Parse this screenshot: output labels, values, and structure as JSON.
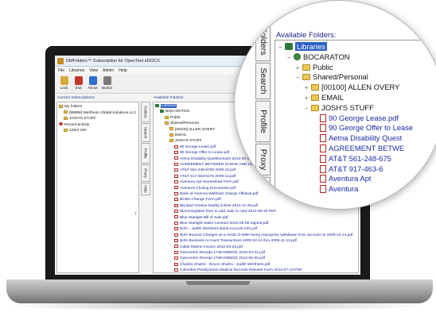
{
  "window": {
    "title": "DMFolders™ Subscription for OpenText eDOCS",
    "minimize": "–",
    "maximize": "□",
    "close": "×"
  },
  "menu": [
    "File",
    "Libraries",
    "View",
    "Admin",
    "Help"
  ],
  "toolbar": {
    "buttons": [
      {
        "label": "Lock",
        "icon": "lock-icon",
        "color": "#d8a93a"
      },
      {
        "label": "Exit",
        "icon": "exit-icon",
        "color": "#c0392b"
      },
      {
        "label": "About",
        "icon": "about-icon",
        "color": "#2e6fcf"
      },
      {
        "label": "Button",
        "icon": "button-icon",
        "color": "#7a7a7a"
      }
    ]
  },
  "left_panel": {
    "header": "Current Subscriptions:",
    "tree": [
      {
        "label": "My folders",
        "level": 0,
        "icon": "folder"
      },
      {
        "label": "[99999] Wertheim Global Solutions LLC",
        "level": 1,
        "icon": "folder"
      },
      {
        "label": "JOSH'S STUFF",
        "level": 1,
        "icon": "folder"
      },
      {
        "label": "Recent activity",
        "level": 0,
        "icon": "clock"
      },
      {
        "label": "Client 100",
        "level": 1,
        "icon": "folder"
      }
    ]
  },
  "tabs": [
    "Folders",
    "Search",
    "Profile",
    "Proxy",
    "Help"
  ],
  "right_panel": {
    "header": "Available Folders:",
    "tree": [
      {
        "label": "Libraries",
        "level": 0,
        "type": "lib"
      },
      {
        "label": "BOCARATON",
        "level": 1,
        "type": "db"
      },
      {
        "label": "Public",
        "level": 2,
        "type": "folder"
      },
      {
        "label": "Shared/Personal",
        "level": 2,
        "type": "folder"
      },
      {
        "label": "[00100] ALLEN OVERY",
        "level": 3,
        "type": "folder"
      },
      {
        "label": "EMAIL",
        "level": 3,
        "type": "folder"
      },
      {
        "label": "JOSH'S STUFF",
        "level": 3,
        "type": "folder"
      },
      {
        "label": "90 George Lease.pdf",
        "level": 4,
        "type": "pdf"
      },
      {
        "label": "90 George Offer to Lease.pdf",
        "level": 4,
        "type": "pdf"
      },
      {
        "label": "Aetna Disability Questionnaire 2012-02-29",
        "level": 4,
        "type": "pdf"
      },
      {
        "label": "AGREEMENT BETWEEN GLENN AND LE",
        "level": 4,
        "type": "pdf"
      },
      {
        "label": "AT&T 561-248-6759 2009-12.pdf",
        "level": 4,
        "type": "pdf"
      },
      {
        "label": "AT&T 917-463-6175 2009-12.pdf",
        "level": 4,
        "type": "pdf"
      },
      {
        "label": "Aventura Apt Homestead Form.pdf",
        "level": 4,
        "type": "pdf"
      },
      {
        "label": "Aventura Closing Documents.pdf",
        "level": 4,
        "type": "pdf"
      },
      {
        "label": "Bank of America Walfmart Charge Affidavit.pdf",
        "level": 4,
        "type": "pdf"
      },
      {
        "label": "BCBS Change Form.pdf",
        "level": 4,
        "type": "pdf"
      },
      {
        "label": "Big Bad Voodoo Daddy tickets 2012-11-29.pdf",
        "level": 4,
        "type": "pdf"
      },
      {
        "label": "Bloomingdales form to add Judy to card 2012-06-30.PDF",
        "level": 4,
        "type": "pdf"
      },
      {
        "label": "Blue Starlight Bill of Sale.pdf",
        "level": 4,
        "type": "pdf"
      },
      {
        "label": "Blue Starlight Sales Contract 2010-05-08 Signed.pdf",
        "level": 4,
        "type": "pdf"
      },
      {
        "label": "BofA - Judith Wertheim Bank Account Info.pdf",
        "level": 4,
        "type": "pdf"
      },
      {
        "label": "BofA Bounce Charges as a result of 6050 being improperly withdrawn from account on 2009-10-14.pdf",
        "level": 4,
        "type": "pdf"
      },
      {
        "label": "BofA Business Account Transactions 2009-10-14 thru 2009-11-13.pdf",
        "level": 4,
        "type": "pdf"
      },
      {
        "label": "Cable Marine Invoice 2012-03-23.pdf",
        "level": 4,
        "type": "pdf"
      },
      {
        "label": "Gancentrix Receipt 1748-0365031 2012-04-21.pdf",
        "level": 4,
        "type": "pdf"
      },
      {
        "label": "Gancentrix Receipt 1748-0365031 2012-06-25.pdf",
        "level": 4,
        "type": "pdf"
      },
      {
        "label": "Charles Shalmi - Devon Shalmi - Judith Wertheim.pdf",
        "level": 4,
        "type": "pdf"
      },
      {
        "label": "Columbia Presbyterian Medical Records Release Form 2012-07-13.PDF",
        "level": 4,
        "type": "pdf"
      },
      {
        "label": "Comcast Bill.pdf",
        "level": 4,
        "type": "pdf"
      }
    ]
  },
  "magnifier": {
    "header": "Available Folders:",
    "tabs": [
      "Folders",
      "Search",
      "Profile",
      "Proxy",
      "Help"
    ],
    "rows": [
      {
        "label": "Libraries",
        "type": "lib",
        "indent": 0,
        "expander": "−"
      },
      {
        "label": "BOCARATON",
        "type": "db",
        "indent": 1,
        "expander": "−"
      },
      {
        "label": "Public",
        "type": "folder",
        "indent": 2,
        "expander": "+"
      },
      {
        "label": "Shared/Personal",
        "type": "folder",
        "indent": 2,
        "expander": "−"
      },
      {
        "label": "[00100] ALLEN OVERY",
        "type": "folder",
        "indent": 3,
        "expander": "+"
      },
      {
        "label": "EMAIL",
        "type": "folder",
        "indent": 3,
        "expander": "+"
      },
      {
        "label": "JOSH'S STUFF",
        "type": "folder",
        "indent": 3,
        "expander": "−"
      },
      {
        "label": "90 George Lease.pdf",
        "type": "pdf",
        "indent": 4,
        "expander": ""
      },
      {
        "label": "90 George Offer to Lease",
        "type": "pdf",
        "indent": 4,
        "expander": ""
      },
      {
        "label": "Aetna Disability Quest",
        "type": "pdf",
        "indent": 4,
        "expander": ""
      },
      {
        "label": "AGREEMENT BETWE",
        "type": "pdf",
        "indent": 4,
        "expander": ""
      },
      {
        "label": "AT&T 561-248-675",
        "type": "pdf",
        "indent": 4,
        "expander": ""
      },
      {
        "label": "AT&T 917-463-6",
        "type": "pdf",
        "indent": 4,
        "expander": ""
      },
      {
        "label": "Aventura Apt",
        "type": "pdf",
        "indent": 4,
        "expander": ""
      },
      {
        "label": "Aventura",
        "type": "pdf",
        "indent": 4,
        "expander": ""
      }
    ]
  },
  "colors": {
    "accent": "#2c5fc5",
    "pdf_text": "#1a2aa8",
    "header_text": "#1c2a8c",
    "laptop_body": "#1b1b1b"
  }
}
